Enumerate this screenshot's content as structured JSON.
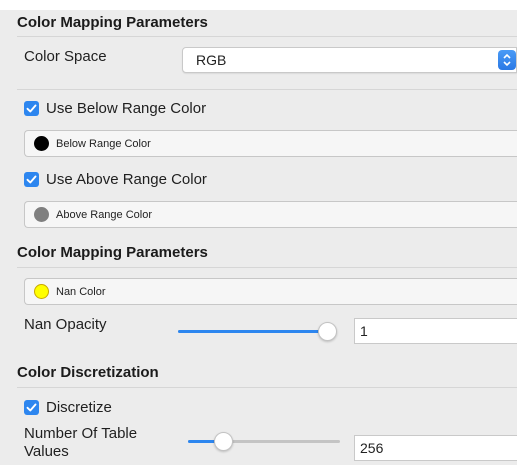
{
  "sections": {
    "color_mapping_1": "Color Mapping Parameters",
    "color_mapping_2": "Color Mapping Parameters",
    "color_discretization": "Color Discretization"
  },
  "color_space": {
    "label": "Color Space",
    "value": "RGB"
  },
  "below_range": {
    "checkbox_label": "Use Below Range Color",
    "checked": true,
    "button_label": "Below Range Color",
    "swatch_color": "#000000"
  },
  "above_range": {
    "checkbox_label": "Use Above Range Color",
    "checked": true,
    "button_label": "Above Range Color",
    "swatch_color": "#7f7f7f"
  },
  "nan": {
    "button_label": "Nan Color",
    "swatch_color": "#ffff00",
    "opacity_label": "Nan Opacity",
    "opacity_value": "1",
    "opacity_slider_fraction": 1.0
  },
  "discretize": {
    "checkbox_label": "Discretize",
    "checked": true,
    "table_values_label_line1": "Number Of Table",
    "table_values_label_line2": "Values",
    "table_values_value": "256"
  },
  "colors": {
    "accent": "#2d86ef",
    "panel_bg": "#ececec"
  }
}
